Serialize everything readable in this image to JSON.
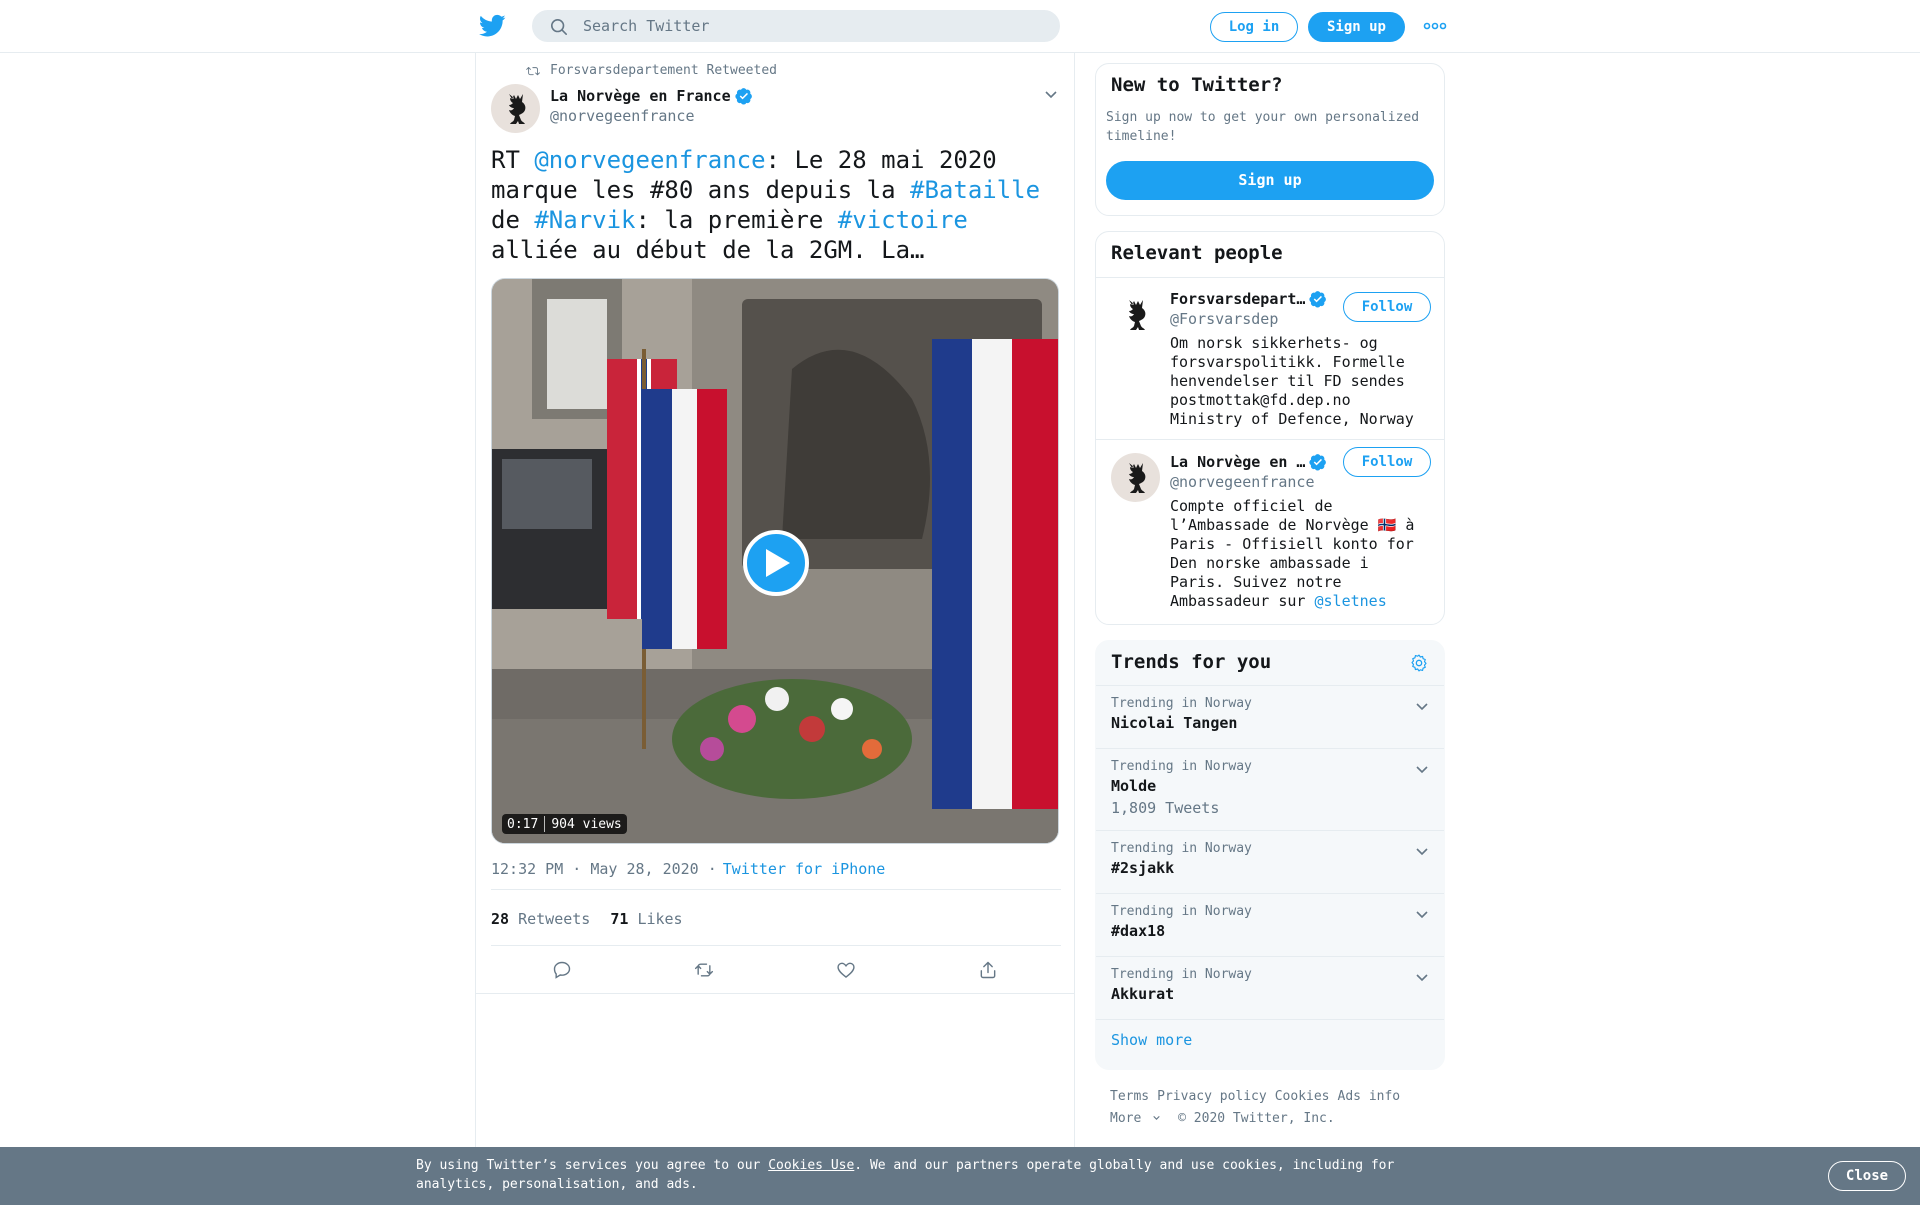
{
  "nav": {
    "logo_icon": "twitter-bird-icon",
    "search_placeholder": "Search Twitter",
    "login_label": "Log in",
    "signup_label": "Sign up",
    "more_icon": "more-dots-icon"
  },
  "colors": {
    "accent": "#1DA1F2",
    "link": "#1B95E0",
    "muted": "#657786",
    "banner": "#657786"
  },
  "tweet": {
    "retweeted_by": "Forsvarsdepartement Retweeted",
    "author_name": "La Norvège en France",
    "author_handle": "@norvegeenfrance",
    "text_parts": [
      {
        "text": "RT ",
        "link": false
      },
      {
        "text": "@norvegeenfrance",
        "link": true
      },
      {
        "text": ": Le 28 mai 2020 marque les #80 ans depuis la ",
        "link": false
      },
      {
        "text": "#Bataille",
        "link": true
      },
      {
        "text": " de ",
        "link": false
      },
      {
        "text": "#Narvik",
        "link": true
      },
      {
        "text": ": la première ",
        "link": false
      },
      {
        "text": "#victoire",
        "link": true
      },
      {
        "text": " alliée au début de la 2GM. La…",
        "link": false
      }
    ],
    "video": {
      "duration": "0:17",
      "views": "904 views"
    },
    "time": "12:32 PM · May 28, 2020 ·",
    "source": "Twitter for iPhone",
    "retweets_count": "28",
    "retweets_label": "Retweets",
    "likes_count": "71",
    "likes_label": "Likes"
  },
  "new_to_twitter": {
    "title": "New to Twitter?",
    "text": "Sign up now to get your own personalized timeline!",
    "button": "Sign up"
  },
  "relevant_people": {
    "title": "Relevant people",
    "people": [
      {
        "name": "Forsvarsdepart…",
        "handle": "@Forsvarsdep",
        "bio": "Om norsk sikkerhets- og forsvarspolitikk. Formelle henvendelser til FD sendes postmottak@fd.dep.no Ministry of Defence, Norway",
        "follow": "Follow"
      },
      {
        "name": "La Norvège en …",
        "handle": "@norvegeenfrance",
        "bio_before": "Compte officiel de l’Ambassade de Norvège 🇳🇴 à Paris - Offisiell konto for Den norske ambassade i Paris. Suivez notre Ambassadeur sur ",
        "bio_link": "@sletnes",
        "follow": "Follow"
      }
    ]
  },
  "trends": {
    "title": "Trends for you",
    "items": [
      {
        "context": "Trending in Norway",
        "name": "Nicolai Tangen",
        "count": ""
      },
      {
        "context": "Trending in Norway",
        "name": "Molde",
        "count": "1,809 Tweets"
      },
      {
        "context": "Trending in Norway",
        "name": "#2sjakk",
        "count": ""
      },
      {
        "context": "Trending in Norway",
        "name": "#dax18",
        "count": ""
      },
      {
        "context": "Trending in Norway",
        "name": "Akkurat",
        "count": ""
      }
    ],
    "show_more": "Show more"
  },
  "footer": {
    "links": [
      "Terms",
      "Privacy policy",
      "Cookies",
      "Ads info"
    ],
    "more": "More",
    "copyright": "© 2020 Twitter, Inc."
  },
  "cookie_banner": {
    "text_before": "By using Twitter’s services you agree to our ",
    "link": "Cookies Use",
    "text_after": ". We and our partners operate globally and use cookies, including for analytics, personalisation, and ads.",
    "close": "Close"
  }
}
